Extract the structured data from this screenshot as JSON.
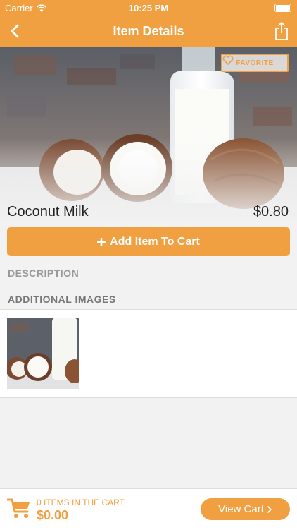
{
  "status_bar": {
    "carrier": "Carrier",
    "time": "10:25 PM"
  },
  "nav": {
    "title": "Item Details"
  },
  "item": {
    "name": "Coconut Milk",
    "price": "$0.80",
    "favorite_label": "FAVORITE"
  },
  "actions": {
    "add_to_cart": "Add Item To Cart"
  },
  "sections": {
    "description": "DESCRIPTION",
    "additional_images": "ADDITIONAL IMAGES"
  },
  "cart": {
    "items_text": "0 ITEMS IN THE CART",
    "total": "$0.00",
    "view_cart": "View Cart"
  },
  "colors": {
    "accent": "#f0a040"
  }
}
